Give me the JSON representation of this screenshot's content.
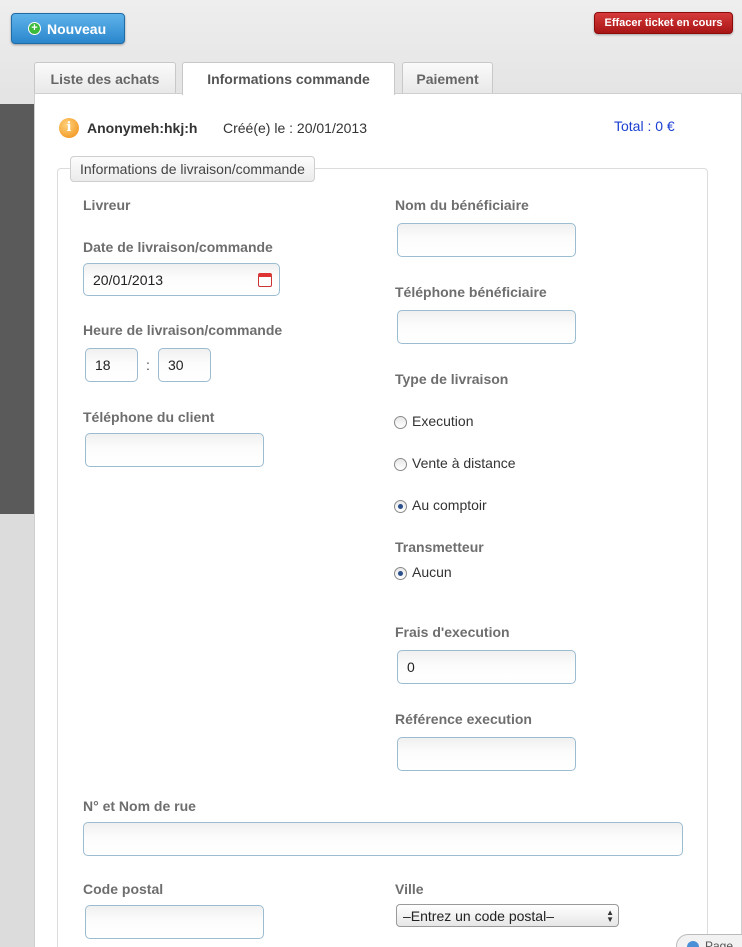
{
  "toolbar": {
    "new_label": "Nouveau",
    "clear_label": "Effacer ticket en cours"
  },
  "tabs": [
    {
      "label": "Liste des achats"
    },
    {
      "label": "Informations commande"
    },
    {
      "label": "Paiement"
    }
  ],
  "order": {
    "user": "Anonymeh:hkj:h",
    "created": "Créé(e) le : 20/01/2013",
    "total": "Total : 0 €"
  },
  "section": {
    "legend": "Informations de livraison/commande"
  },
  "form": {
    "livreur_label": "Livreur",
    "date_label": "Date de livraison/commande",
    "date_value": "20/01/2013",
    "time_label": "Heure de livraison/commande",
    "hour_value": "18",
    "minute_value": "30",
    "time_separator": ":",
    "client_phone_label": "Téléphone du client",
    "beneficiary_name_label": "Nom du bénéficiaire",
    "beneficiary_phone_label": "Téléphone bénéficiaire",
    "delivery_type_label": "Type de livraison",
    "delivery_types": [
      {
        "label": "Execution",
        "checked": false
      },
      {
        "label": "Vente à distance",
        "checked": false
      },
      {
        "label": "Au comptoir",
        "checked": true
      }
    ],
    "transmitter_label": "Transmetteur",
    "transmitter_option": "Aucun",
    "fees_label": "Frais d'execution",
    "fees_value": "0",
    "reference_label": "Référence execution",
    "street_label": "N° et Nom de rue",
    "postal_label": "Code postal",
    "city_label": "Ville",
    "city_select_value": "–Entrez un code postal–"
  },
  "footer": {
    "page_badge": "Page"
  },
  "colors": {
    "new_button": "#2a86cc",
    "clear_button": "#a81515",
    "total_text": "#1a3fd1"
  }
}
